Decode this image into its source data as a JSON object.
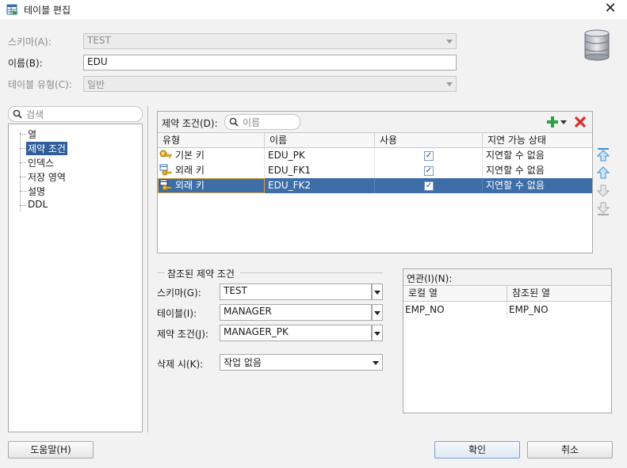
{
  "window": {
    "title": "테이블 편집",
    "close_glyph": "✕"
  },
  "schema": {
    "label": "스키마(A):",
    "value": "TEST"
  },
  "name": {
    "label": "이름(B):",
    "value": "EDU"
  },
  "table_type": {
    "label": "테이블 유형(C):",
    "value": "일반"
  },
  "nav": {
    "search_placeholder": "검색",
    "items": [
      {
        "label": "열",
        "selected": false
      },
      {
        "label": "제약 조건",
        "selected": true
      },
      {
        "label": "인덱스",
        "selected": false
      },
      {
        "label": "저장 영역",
        "selected": false
      },
      {
        "label": "설명",
        "selected": false
      },
      {
        "label": "DDL",
        "selected": false
      }
    ]
  },
  "constraints": {
    "label": "제약 조건(D):",
    "filter_placeholder": "이름",
    "add_icon": "plus-icon",
    "remove_icon": "delete-x-icon",
    "columns": [
      "유형",
      "이름",
      "사용",
      "지연 가능 상태"
    ],
    "rows": [
      {
        "type": "기본 키",
        "name": "EDU_PK",
        "enabled": true,
        "deferrable": "지연할 수 없음",
        "icon": "primary-key-icon",
        "selected": false
      },
      {
        "type": "외래 키",
        "name": "EDU_FK1",
        "enabled": true,
        "deferrable": "지연할 수 없음",
        "icon": "foreign-key-icon",
        "selected": false
      },
      {
        "type": "외래 키",
        "name": "EDU_FK2",
        "enabled": true,
        "deferrable": "지연할 수 없음",
        "icon": "foreign-key-icon",
        "selected": true
      }
    ]
  },
  "referenced": {
    "group_title": "참조된 제약 조건",
    "schema_label": "스키마(G):",
    "schema_value": "TEST",
    "table_label": "테이블(I):",
    "table_value": "MANAGER",
    "constraint_label": "제약 조건(J):",
    "constraint_value": "MANAGER_PK",
    "on_delete_label": "삭제 시(K):",
    "on_delete_value": "작업 없음"
  },
  "association": {
    "label": "연관(I)(N):",
    "columns": [
      "로컬 열",
      "참조된 열"
    ],
    "rows": [
      {
        "local": "EMP_NO",
        "referenced": "EMP_NO"
      }
    ]
  },
  "buttons": {
    "help": "도움말(H)",
    "ok": "확인",
    "cancel": "취소"
  }
}
